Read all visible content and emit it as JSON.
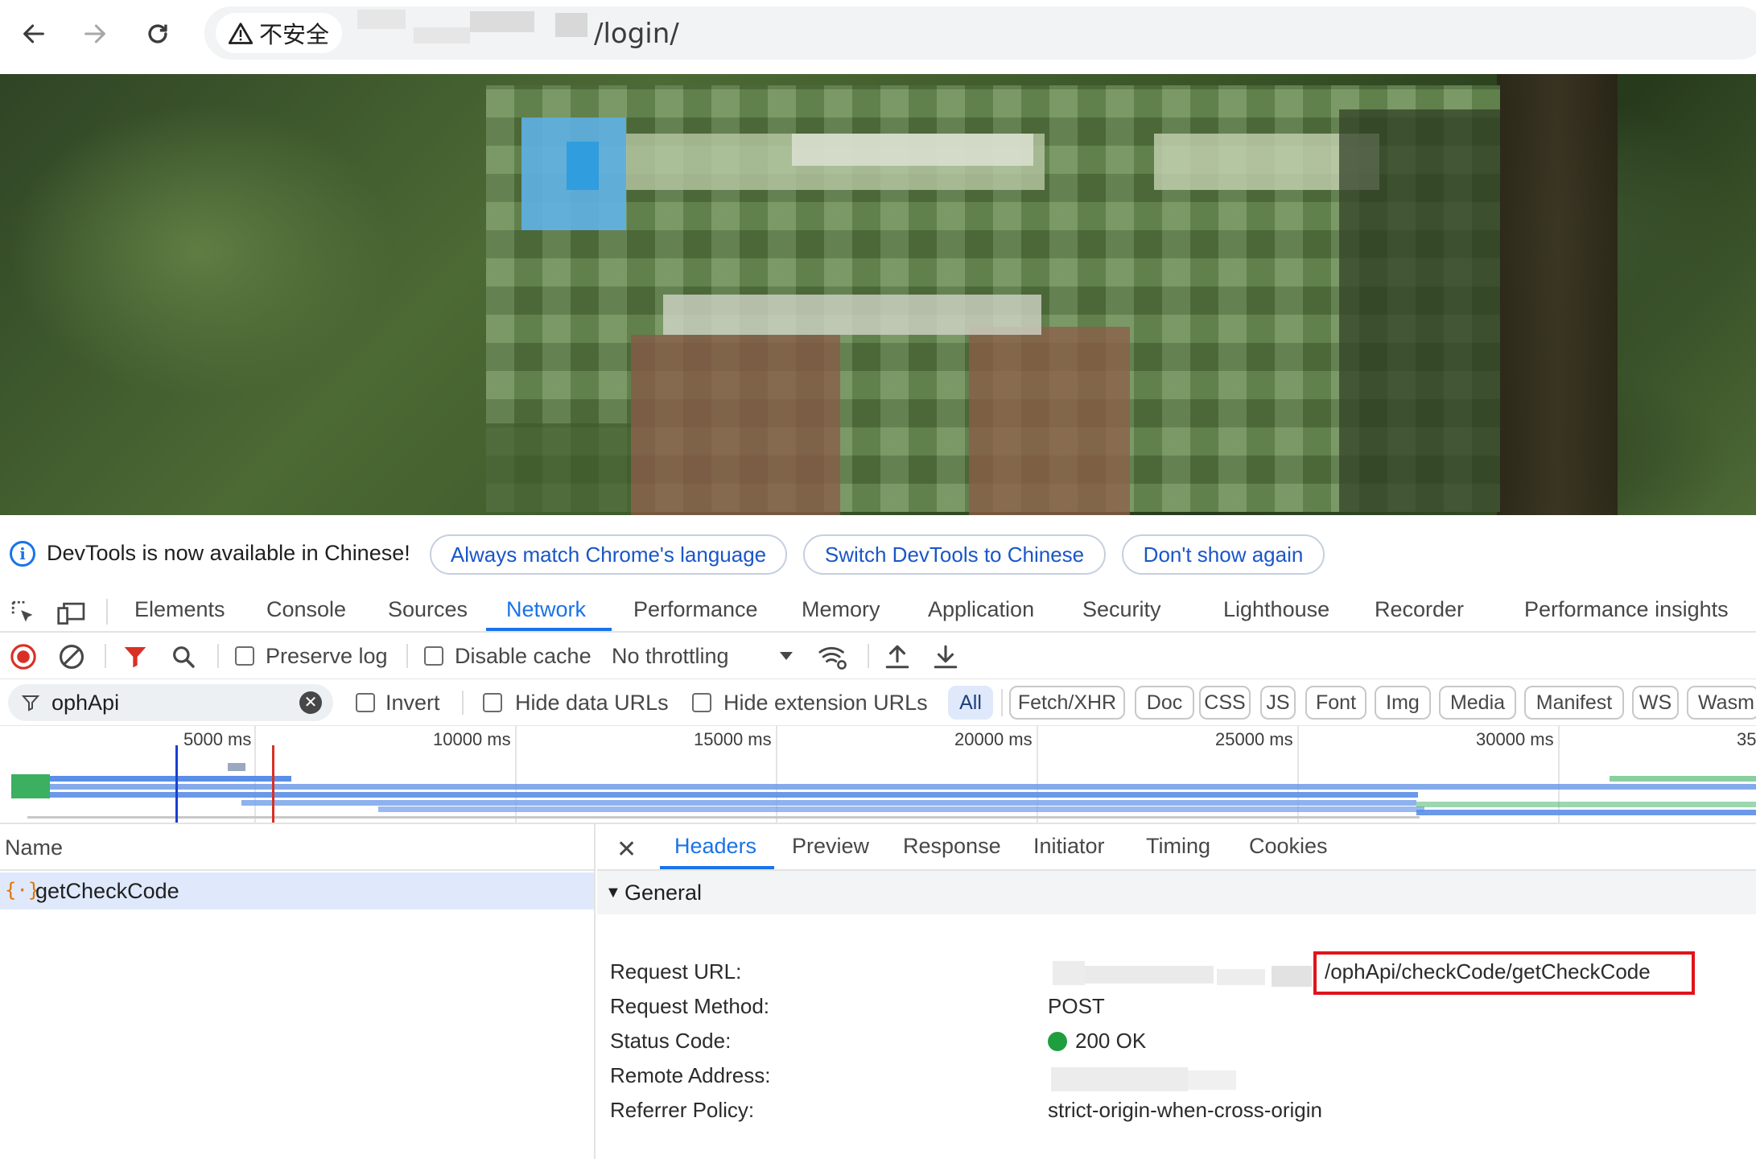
{
  "browser": {
    "security_label": "不安全",
    "url_path": "/login/"
  },
  "devtools_infobar": {
    "message": "DevTools is now available in Chinese!",
    "buttons": [
      "Always match Chrome's language",
      "Switch DevTools to Chinese",
      "Don't show again"
    ]
  },
  "main_tabs": [
    "Elements",
    "Console",
    "Sources",
    "Network",
    "Performance",
    "Memory",
    "Application",
    "Security",
    "Lighthouse",
    "Recorder",
    "Performance insights"
  ],
  "active_main_tab": "Network",
  "toolbar": {
    "preserve_log": "Preserve log",
    "disable_cache": "Disable cache",
    "throttling": "No throttling"
  },
  "filter": {
    "value": "ophApi",
    "invert": "Invert",
    "hide_data_urls": "Hide data URLs",
    "hide_extension_urls": "Hide extension URLs",
    "types": [
      "All",
      "Fetch/XHR",
      "Doc",
      "CSS",
      "JS",
      "Font",
      "Img",
      "Media",
      "Manifest",
      "WS",
      "Wasm"
    ]
  },
  "timeline": {
    "ticks": [
      "5000 ms",
      "10000 ms",
      "15000 ms",
      "20000 ms",
      "25000 ms",
      "30000 ms",
      "35"
    ]
  },
  "requests": {
    "column_name": "Name",
    "items": [
      {
        "name": "getCheckCode",
        "icon": "xhr-icon"
      }
    ]
  },
  "detail": {
    "tabs": [
      "Headers",
      "Preview",
      "Response",
      "Initiator",
      "Timing",
      "Cookies"
    ],
    "active_tab": "Headers",
    "section_title": "General",
    "rows": [
      {
        "key": "Request URL:",
        "value": "/ophApi/checkCode/getCheckCode"
      },
      {
        "key": "Request Method:",
        "value": "POST"
      },
      {
        "key": "Status Code:",
        "value": "200 OK",
        "status_color": "#1e9e3e"
      },
      {
        "key": "Remote Address:",
        "value": ""
      },
      {
        "key": "Referrer Policy:",
        "value": "strict-origin-when-cross-origin"
      }
    ]
  },
  "colors": {
    "accent": "#1a73e8",
    "highlight_box": "#e0141b",
    "record_stop": "#d93025",
    "filter_funnel": "#d93025"
  }
}
